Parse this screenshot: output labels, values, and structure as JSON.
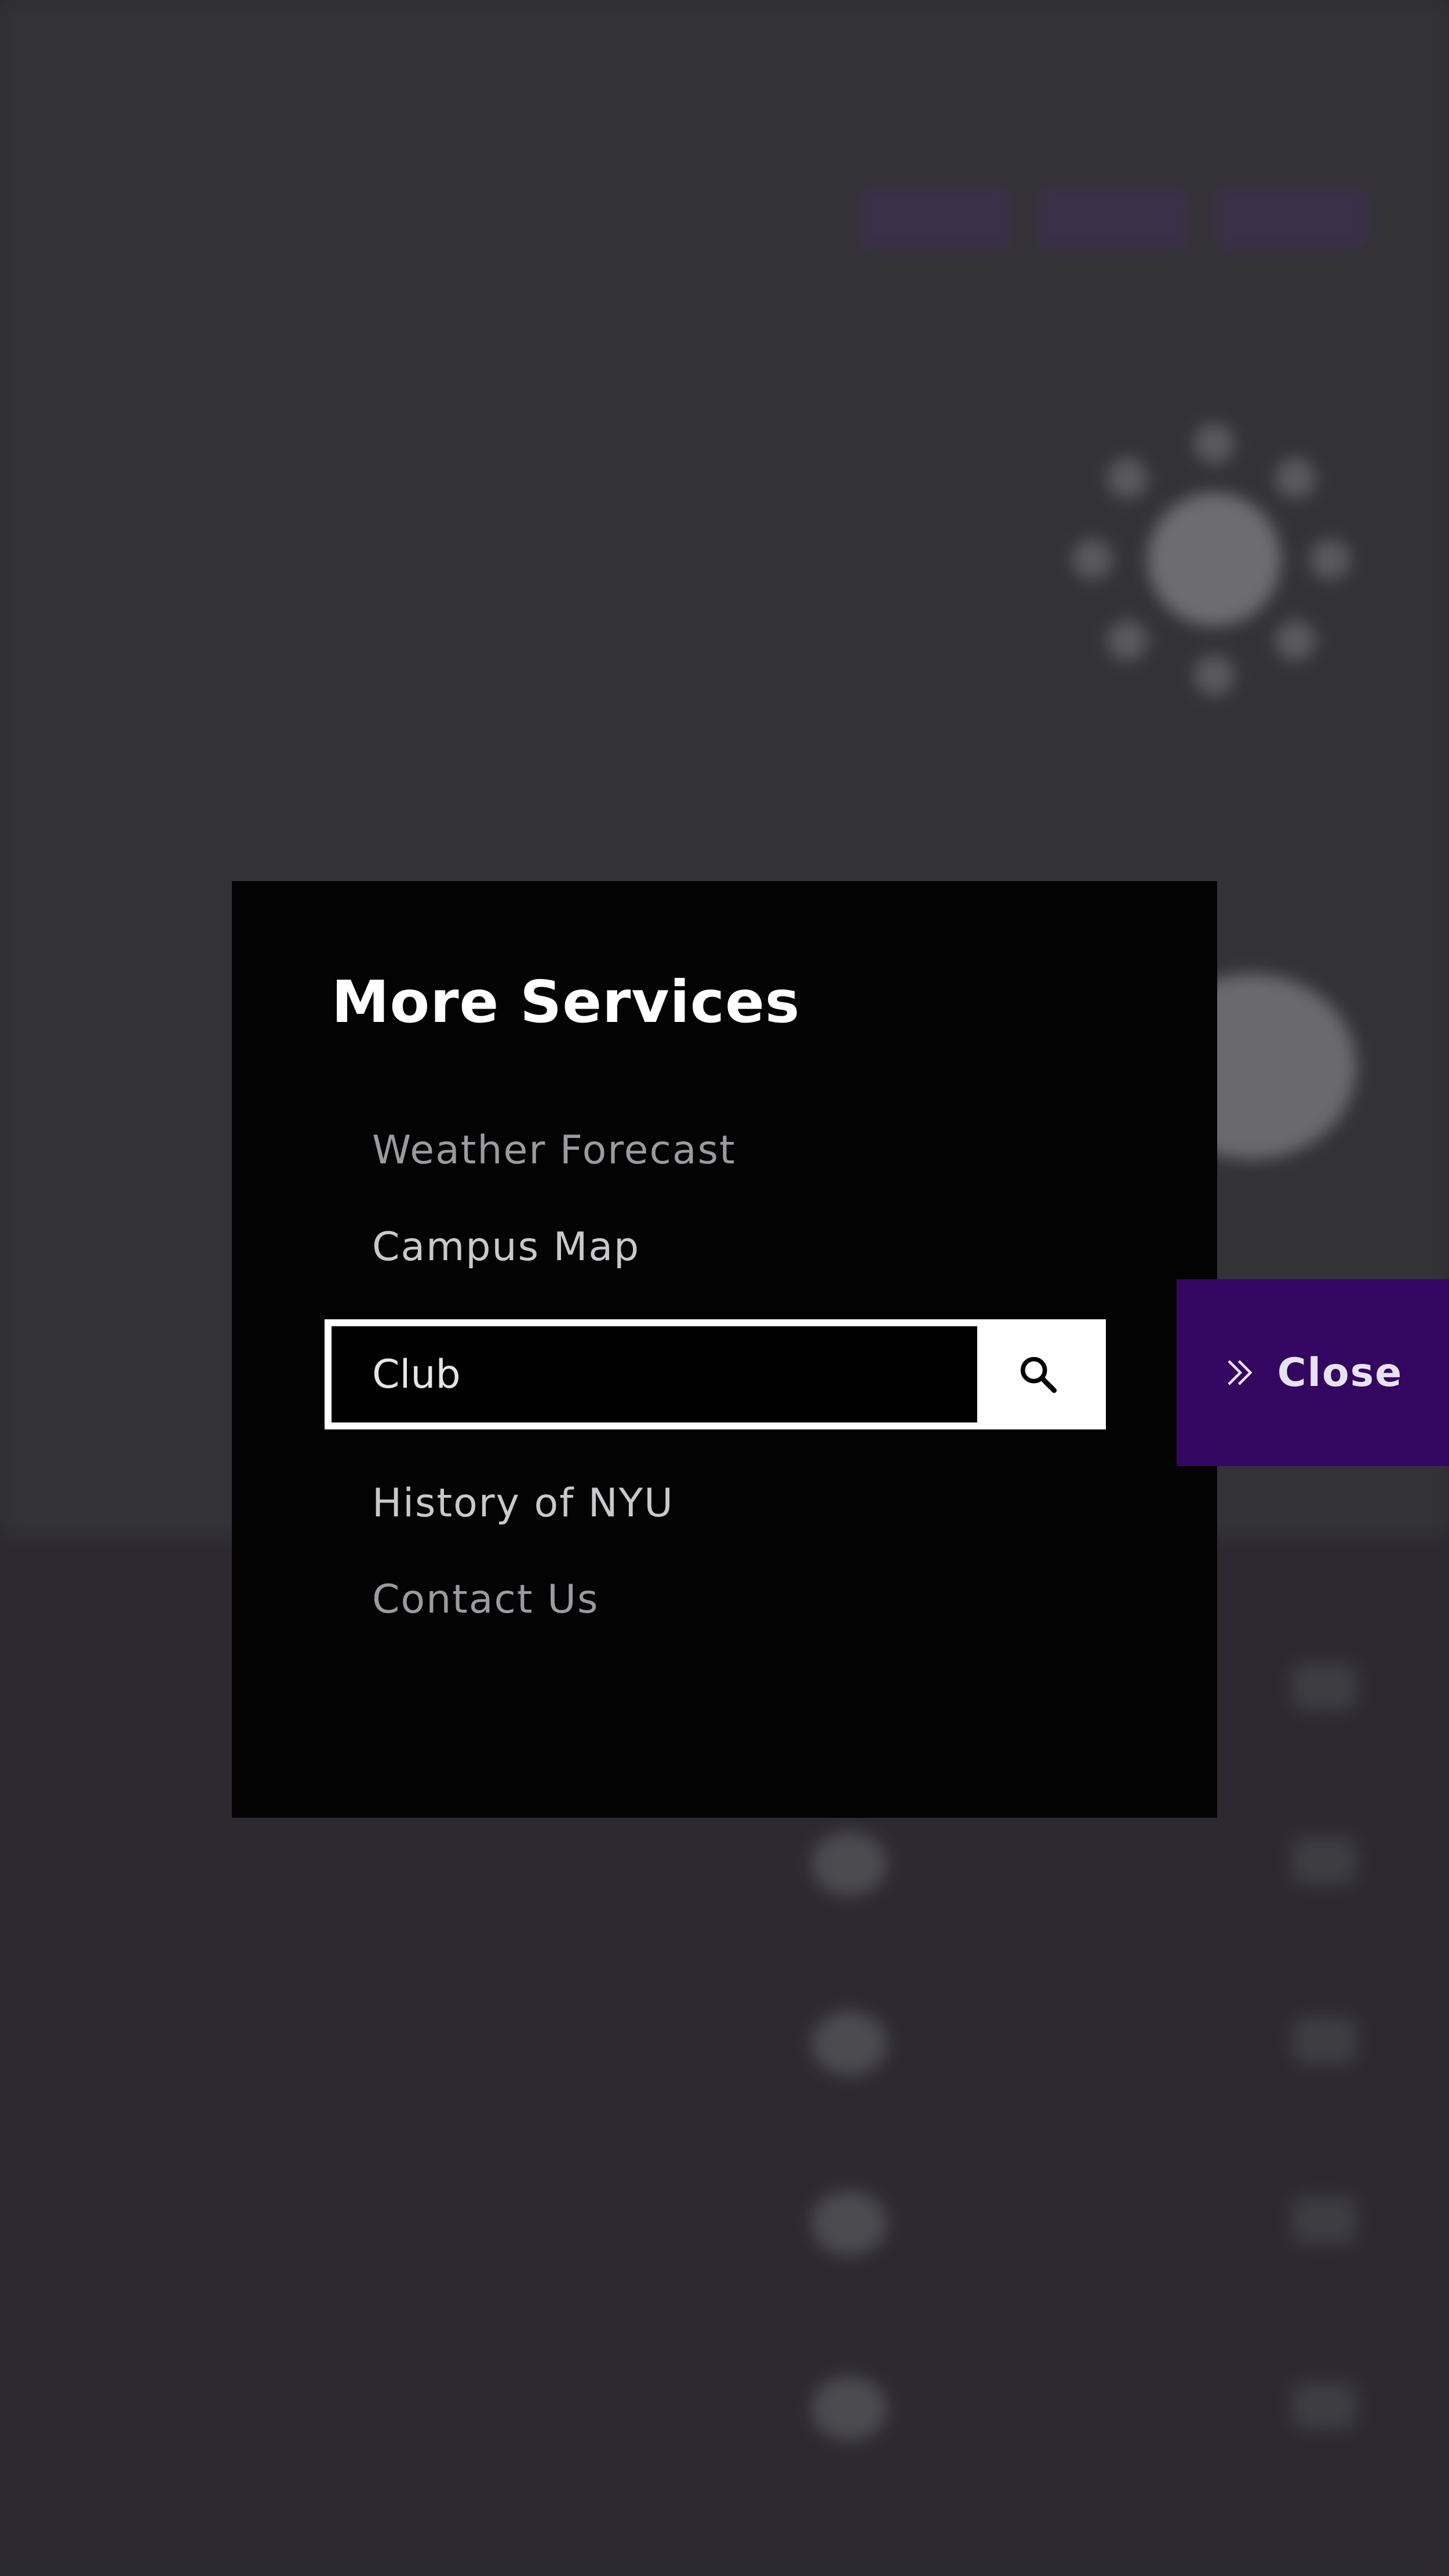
{
  "modal": {
    "title": "More Services",
    "links": [
      {
        "label": "Weather Forecast",
        "color": "#9b9b9f"
      },
      {
        "label": "Campus Map",
        "color": "#c9c9cc"
      }
    ],
    "search": {
      "value": "Club",
      "icon": "search-icon"
    },
    "links_after": [
      {
        "label": "History of NYU",
        "color": "#c9c9cc"
      },
      {
        "label": "Contact Us",
        "color": "#9b9b9f"
      }
    ]
  },
  "close_tab": {
    "label": "Close",
    "icon": "double-chevron-right-icon",
    "color": "#330661"
  }
}
